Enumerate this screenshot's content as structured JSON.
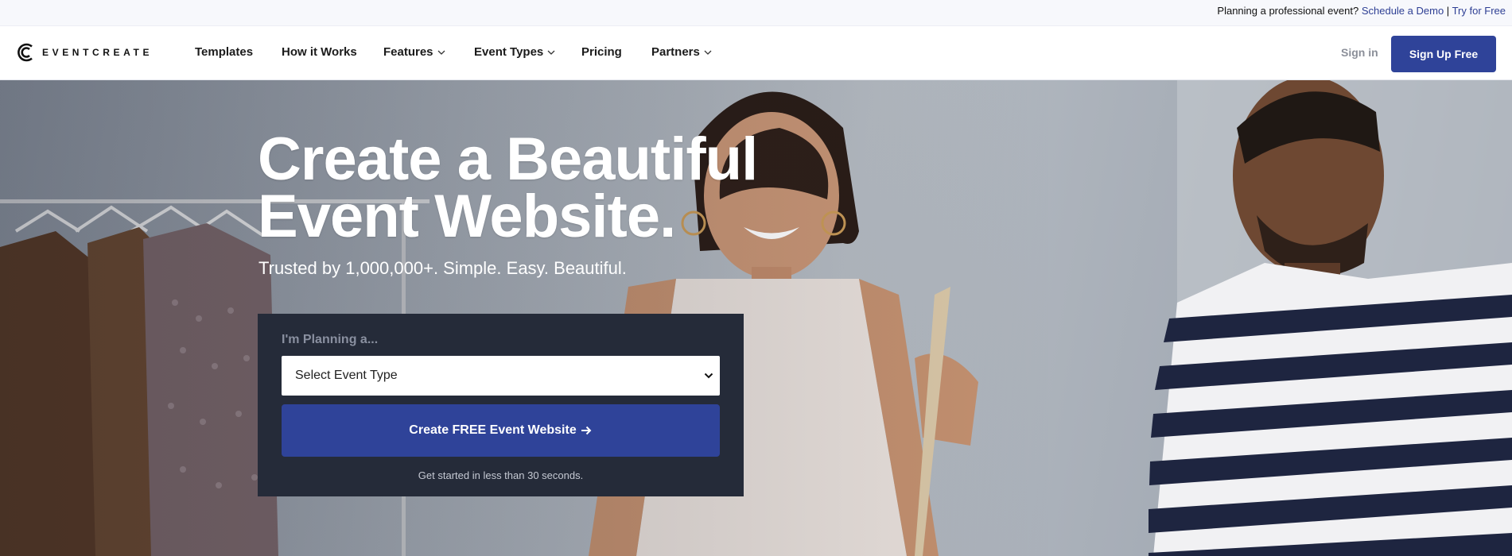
{
  "topbar": {
    "prompt": "Planning a professional event?",
    "demo_link": "Schedule a Demo",
    "separator": "|",
    "trial_link": "Try for Free"
  },
  "brand": {
    "name": "EVENTCREATE",
    "icon": "eventcreate-logo-icon"
  },
  "nav": {
    "items": [
      {
        "label": "Templates",
        "dropdown": false
      },
      {
        "label": "How it Works",
        "dropdown": false
      },
      {
        "label": "Features",
        "dropdown": true
      },
      {
        "label": "Event Types",
        "dropdown": true
      },
      {
        "label": "Pricing",
        "dropdown": false
      },
      {
        "label": "Partners",
        "dropdown": true
      }
    ],
    "signin": "Sign in",
    "signup": "Sign Up Free"
  },
  "hero": {
    "headline_line1": "Create a Beautiful",
    "headline_line2": "Event Website.",
    "subheadline": "Trusted by 1,000,000+. Simple. Easy. Beautiful.",
    "form": {
      "label": "I'm Planning a...",
      "select_value": "Select Event Type",
      "cta": "Create FREE Event Website",
      "note": "Get started in less than 30 seconds."
    }
  },
  "colors": {
    "brand_blue": "#2f4399",
    "card_dark": "#252b39",
    "link_blue": "#2e3f94"
  }
}
